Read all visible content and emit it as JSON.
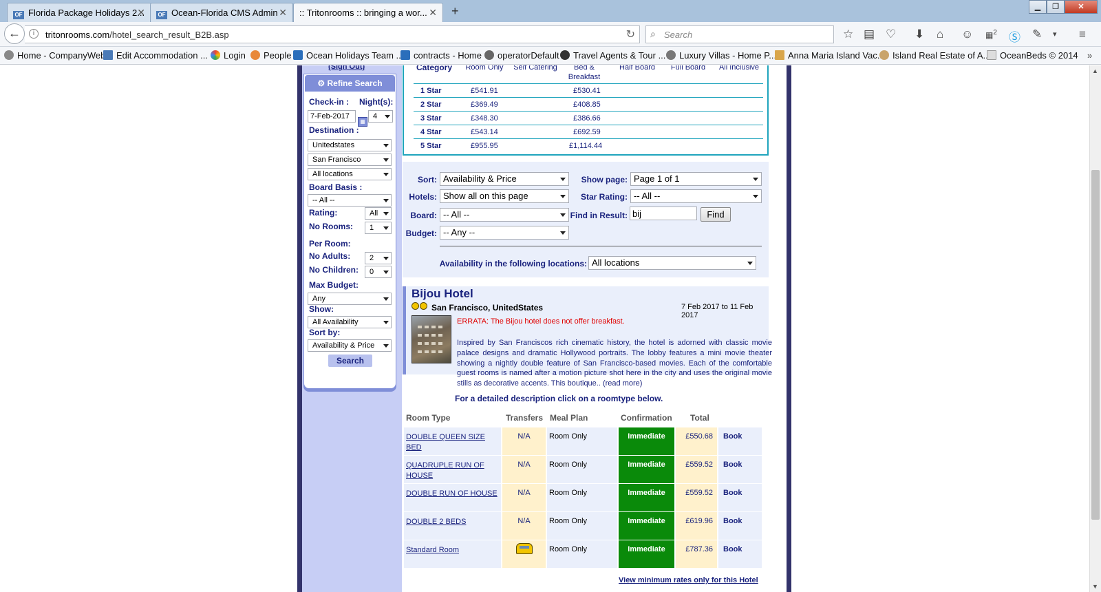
{
  "browser": {
    "tabs": [
      {
        "favicon": "OF",
        "title": "Florida Package Holidays 2..."
      },
      {
        "favicon": "OF",
        "title": "Ocean-Florida CMS Admin"
      },
      {
        "favicon": "",
        "title": ":: Tritonrooms :: bringing a wor..."
      }
    ],
    "url_domain": "tritonrooms.com",
    "url_path": "/hotel_search_result_B2B.asp",
    "search_placeholder": "Search",
    "notification_badge": "2",
    "bookmarks": [
      "Home - CompanyWeb",
      "Edit Accommodation ...",
      "Login",
      "People",
      "Ocean Holidays Team ...",
      "contracts - Home",
      "operatorDefault",
      "Travel Agents & Tour ...",
      "Luxury Villas - Home P...",
      "Anna Maria Island Vac...",
      "Island Real Estate of A...",
      "OceanBeds © 2014"
    ]
  },
  "sidebar": {
    "signout": "(Sign Out)",
    "refine": "Refine Search",
    "checkin_label": "Check-in :",
    "nights_label": "Night(s):",
    "checkin_value": "7-Feb-2017",
    "nights_value": "4",
    "destination_label": "Destination :",
    "country": "Unitedstates",
    "city": "San Francisco",
    "location": "All locations",
    "board_label": "Board Basis :",
    "board_value": "-- All --",
    "rating_label": "Rating:",
    "rating_value": "All",
    "rooms_label": "No Rooms:",
    "rooms_value": "1",
    "perroom_label": "Per Room:",
    "adults_label": "No Adults:",
    "adults_value": "2",
    "children_label": "No Children:",
    "children_value": "0",
    "budget_label": "Max Budget:",
    "budget_value": "Any",
    "show_label": "Show:",
    "show_value": "All Availability",
    "sortby_label": "Sort by:",
    "sortby_value": "Availability & Price",
    "search_button": "Search"
  },
  "category_table": {
    "headers": [
      "Category",
      "Room Only",
      "Self Catering",
      "Bed & Breakfast",
      "Half Board",
      "Full Board",
      "All Inclusive"
    ],
    "rows": [
      {
        "category": "1 Star",
        "room_only": "£541.91",
        "bed_breakfast": "£530.41"
      },
      {
        "category": "2 Star",
        "room_only": "£369.49",
        "bed_breakfast": "£408.85"
      },
      {
        "category": "3 Star",
        "room_only": "£348.30",
        "bed_breakfast": "£386.66"
      },
      {
        "category": "4 Star",
        "room_only": "£543.14",
        "bed_breakfast": "£692.59"
      },
      {
        "category": "5 Star",
        "room_only": "£955.95",
        "bed_breakfast": "£1,114.44"
      }
    ]
  },
  "sort_panel": {
    "sort_label": "Sort:",
    "sort_value": "Availability & Price",
    "showpage_label": "Show page:",
    "showpage_value": "Page 1 of 1",
    "hotels_label": "Hotels:",
    "hotels_value": "Show all on this page",
    "starrating_label": "Star Rating:",
    "starrating_value": "-- All --",
    "board_label": "Board:",
    "board_value": "-- All --",
    "find_label": "Find in Result:",
    "find_value": "bij",
    "find_button": "Find",
    "budget_label": "Budget:",
    "budget_value": "-- Any --",
    "availability_label": "Availability in the following locations:",
    "availability_value": "All locations"
  },
  "hotel": {
    "name": "Bijou Hotel",
    "star_rating": 2,
    "location": "San Francisco, UnitedStates",
    "dates": "7 Feb 2017 to 11 Feb 2017",
    "errata": "ERRATA: The Bijou hotel does not offer breakfast.",
    "description": "Inspired by San Franciscos rich cinematic history, the hotel is adorned with classic movie palace designs and dramatic Hollywood portraits. The lobby features a mini movie theater showing a nightly double feature of San Francisco-based movies. Each of the comfortable guest rooms is named after a motion picture shot here in the city and uses the original movie stills as decorative accents. This boutique..",
    "read_more": "(read more)",
    "detail_note": "For a detailed description click on a roomtype below."
  },
  "rooms": {
    "headers": [
      "Room Type",
      "Transfers",
      "Meal Plan",
      "Confirmation",
      "Total"
    ],
    "rows": [
      {
        "type": "DOUBLE QUEEN SIZE BED",
        "transfers": "N/A",
        "meal": "Room Only",
        "confirmation": "Immediate",
        "total": "£550.68",
        "action": "Book"
      },
      {
        "type": "QUADRUPLE RUN OF HOUSE",
        "transfers": "N/A",
        "meal": "Room Only",
        "confirmation": "Immediate",
        "total": "£559.52",
        "action": "Book"
      },
      {
        "type": "DOUBLE RUN OF HOUSE",
        "transfers": "N/A",
        "meal": "Room Only",
        "confirmation": "Immediate",
        "total": "£559.52",
        "action": "Book"
      },
      {
        "type": "DOUBLE 2 BEDS",
        "transfers": "N/A",
        "meal": "Room Only",
        "confirmation": "Immediate",
        "total": "£619.96",
        "action": "Book"
      },
      {
        "type": "Standard Room",
        "transfers": "taxi-icon",
        "meal": "Room Only",
        "confirmation": "Immediate",
        "total": "£787.36",
        "action": "Book"
      }
    ],
    "view_min_rates": "View minimum rates only for this Hotel"
  },
  "colors": {
    "navy": "#1a237e",
    "sidebar_bg": "#c7cef5",
    "accent_cyan": "#1fa4bd",
    "confirm_green": "#0a8a0a",
    "errata_red": "#e00000"
  }
}
